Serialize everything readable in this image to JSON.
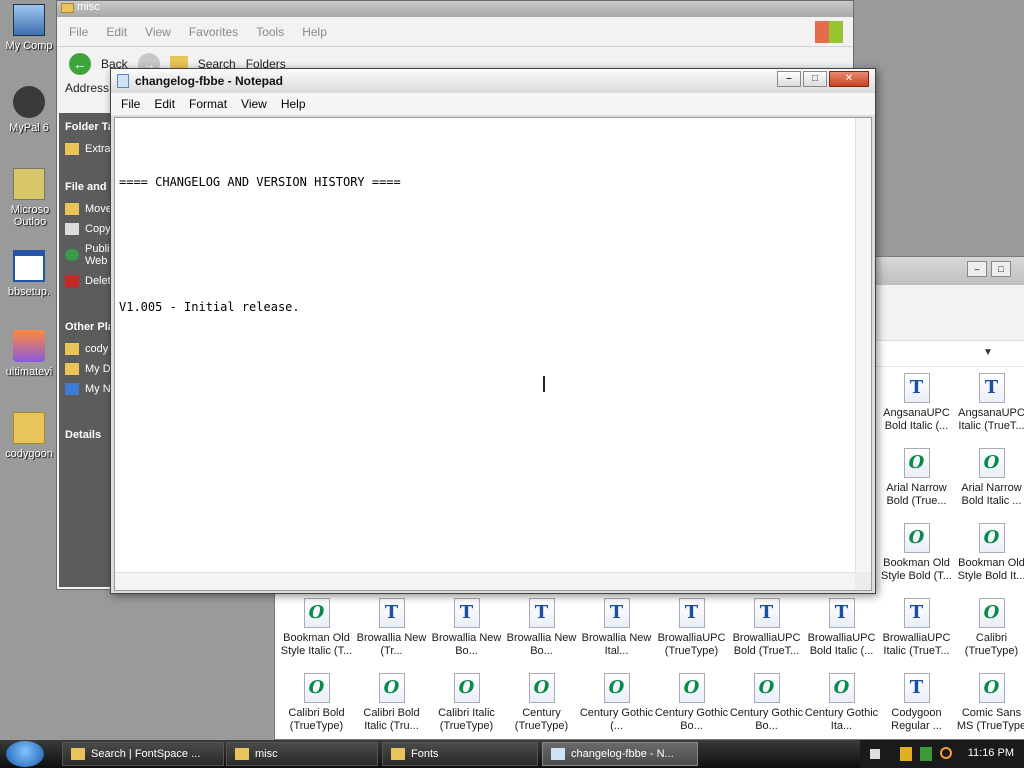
{
  "desktop": {
    "icons": [
      {
        "label": "My Comp"
      },
      {
        "label": "MyPal 6"
      },
      {
        "label": "Microso Outloo"
      },
      {
        "label": "bbsetup."
      },
      {
        "label": "ultimatevi"
      },
      {
        "label": "codygoon"
      }
    ]
  },
  "explorer": {
    "title": "misc",
    "menu": [
      "File",
      "Edit",
      "View",
      "Favorites",
      "Tools",
      "Help"
    ],
    "toolbar": {
      "back": "Back",
      "search": "Search",
      "folders": "Folders"
    },
    "address_label": "Address",
    "left_pane": {
      "folder_tasks": "Folder Ta",
      "folder_task_items": [
        "Extra"
      ],
      "file_tasks": "File and I",
      "file_task_items": [
        "Move",
        "Copy",
        "Publi Web",
        "Delet"
      ],
      "other_places": "Other Pla",
      "other_items": [
        "cody",
        "My D",
        "My N"
      ],
      "details": "Details"
    }
  },
  "fonts_window": {
    "title": "Fonts",
    "items": [
      {
        "label": "AngsanaUPC Bold Italic (...",
        "icon": "T"
      },
      {
        "label": "AngsanaUPC Italic (TrueT...",
        "icon": "T"
      },
      {
        "label": "Arial Narrow Bold (True...",
        "icon": "O"
      },
      {
        "label": "Arial Narrow Bold Italic ...",
        "icon": "O"
      },
      {
        "label": "Bookman Old Style Bold (T...",
        "icon": "O"
      },
      {
        "label": "Bookman Old Style Bold It...",
        "icon": "O"
      },
      {
        "label": "Bookman Old Style Italic (T...",
        "icon": "O"
      },
      {
        "label": "Browallia New (Tr...",
        "icon": "T"
      },
      {
        "label": "Browallia New Bo...",
        "icon": "T"
      },
      {
        "label": "Browallia New Bo...",
        "icon": "T"
      },
      {
        "label": "Browallia New Ital...",
        "icon": "T"
      },
      {
        "label": "BrowalliaUPC (TrueType)",
        "icon": "T"
      },
      {
        "label": "BrowalliaUPC Bold (TrueT...",
        "icon": "T"
      },
      {
        "label": "BrowalliaUPC Bold Italic (...",
        "icon": "T"
      },
      {
        "label": "BrowalliaUPC Italic (TrueT...",
        "icon": "T"
      },
      {
        "label": "Calibri (TrueType)",
        "icon": "O"
      },
      {
        "label": "Calibri Bold (TrueType)",
        "icon": "O"
      },
      {
        "label": "Calibri Bold Italic (Tru...",
        "icon": "O"
      },
      {
        "label": "Calibri Italic (TrueType)",
        "icon": "O"
      },
      {
        "label": "Century (TrueType)",
        "icon": "O"
      },
      {
        "label": "Century Gothic (...",
        "icon": "O"
      },
      {
        "label": "Century Gothic Bo...",
        "icon": "O"
      },
      {
        "label": "Century Gothic Bo...",
        "icon": "O"
      },
      {
        "label": "Century Gothic Ita...",
        "icon": "O"
      },
      {
        "label": "Codygoon Regular ...",
        "icon": "T"
      },
      {
        "label": "Comic Sans MS (TrueType",
        "icon": "O"
      }
    ]
  },
  "notepad": {
    "title": "changelog-fbbe - Notepad",
    "menu": [
      "File",
      "Edit",
      "Format",
      "View",
      "Help"
    ],
    "lines": [
      "==== CHANGELOG AND VERSION HISTORY ====",
      "",
      "V1.005 - Initial release."
    ]
  },
  "taskbar": {
    "buttons": [
      {
        "label": "Search | FontSpace ...",
        "active": false
      },
      {
        "label": "misc",
        "active": false
      },
      {
        "label": "Fonts",
        "active": false
      },
      {
        "label": "changelog-fbbe - N...",
        "active": true
      }
    ],
    "clock": "11:16 PM"
  }
}
